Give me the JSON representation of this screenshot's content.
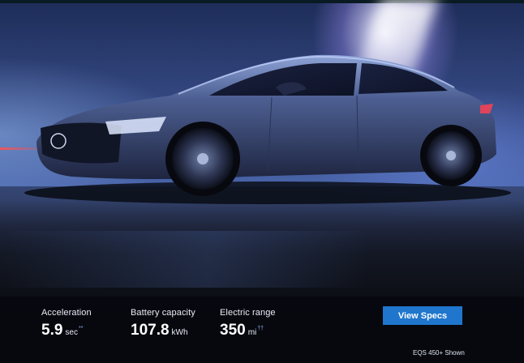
{
  "hero": {
    "image_alt": "Mercedes EQS sedan",
    "caption": "EQS 450+ Shown"
  },
  "specs": [
    {
      "label": "Acceleration",
      "value": "5.9",
      "unit": "sec",
      "note": "**"
    },
    {
      "label": "Battery capacity",
      "value": "107.8",
      "unit": "kWh",
      "note": ""
    },
    {
      "label": "Electric range",
      "value": "350",
      "unit": "mi",
      "note": "††"
    }
  ],
  "cta": {
    "view_specs_label": "View Specs"
  },
  "colors": {
    "button": "#1f76cc",
    "spec_bar": "#06080e"
  }
}
